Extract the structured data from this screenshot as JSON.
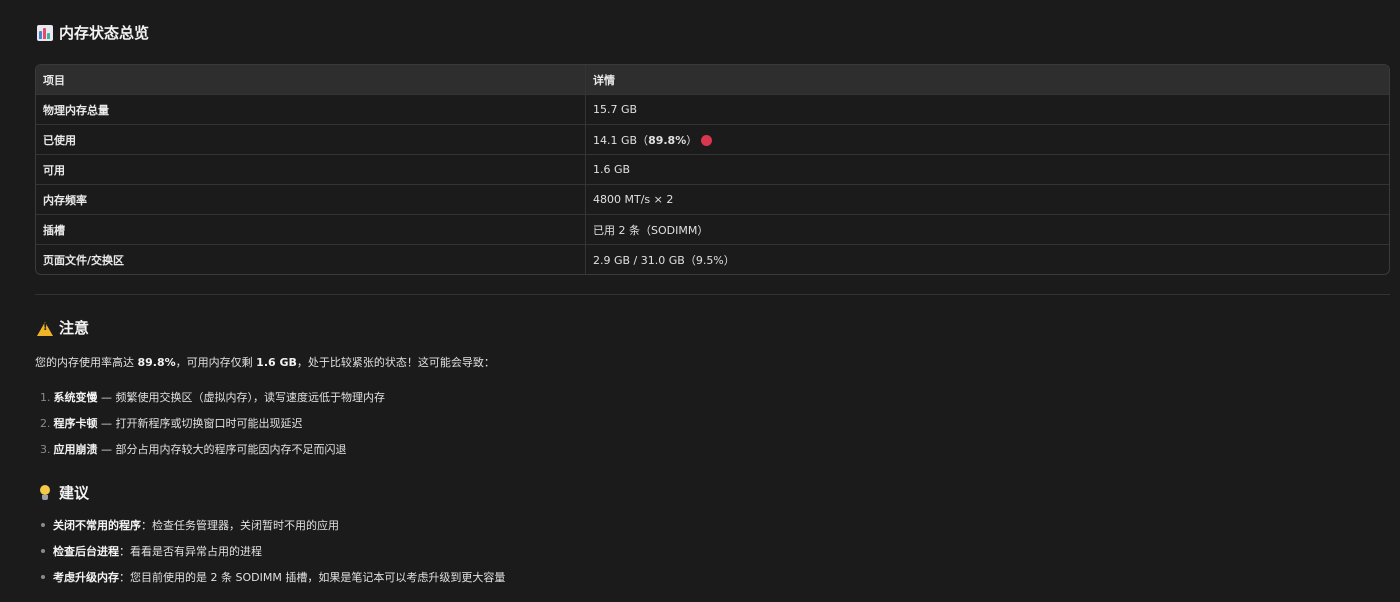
{
  "overview": {
    "title": "内存状态总览",
    "icon": "bar-chart-icon",
    "table": {
      "headers": [
        "项目",
        "详情"
      ],
      "rows": [
        {
          "label": "物理内存总量",
          "value": "15.7 GB"
        },
        {
          "label": "已使用",
          "value": "14.1 GB（",
          "value_bold": "89.8%",
          "value_suffix": "）",
          "status_color": "#d9364f"
        },
        {
          "label": "可用",
          "value": "1.6 GB"
        },
        {
          "label": "内存频率",
          "value": "4800 MT/s × 2"
        },
        {
          "label": "插槽",
          "value": "已用 2 条（SODIMM）"
        },
        {
          "label": "页面文件/交换区",
          "value": "2.9 GB / 31.0 GB（9.5%）"
        }
      ]
    }
  },
  "warning": {
    "title": "注意",
    "icon": "warning-icon",
    "paragraph": {
      "p1": "您的内存使用率高达 ",
      "b1": "89.8%",
      "p2": "，可用内存仅剩 ",
      "b2": "1.6 GB",
      "p3": "，处于比较紧张的状态！这可能会导致："
    },
    "items": [
      {
        "num": "1.",
        "bold": "系统变慢",
        "text": " — 频繁使用交换区（虚拟内存），读写速度远低于物理内存"
      },
      {
        "num": "2.",
        "bold": "程序卡顿",
        "text": " — 打开新程序或切换窗口时可能出现延迟"
      },
      {
        "num": "3.",
        "bold": "应用崩溃",
        "text": " — 部分占用内存较大的程序可能因内存不足而闪退"
      }
    ]
  },
  "tips": {
    "title": "建议",
    "icon": "lightbulb-icon",
    "items": [
      {
        "bold": "关闭不常用的程序",
        "text": "：检查任务管理器，关闭暂时不用的应用"
      },
      {
        "bold": "检查后台进程",
        "text": "：看看是否有异常占用的进程"
      },
      {
        "bold": "考虑升级内存",
        "text": "：您目前使用的是 2 条 SODIMM 插槽，如果是笔记本可以考虑升级到更大容量"
      }
    ]
  }
}
